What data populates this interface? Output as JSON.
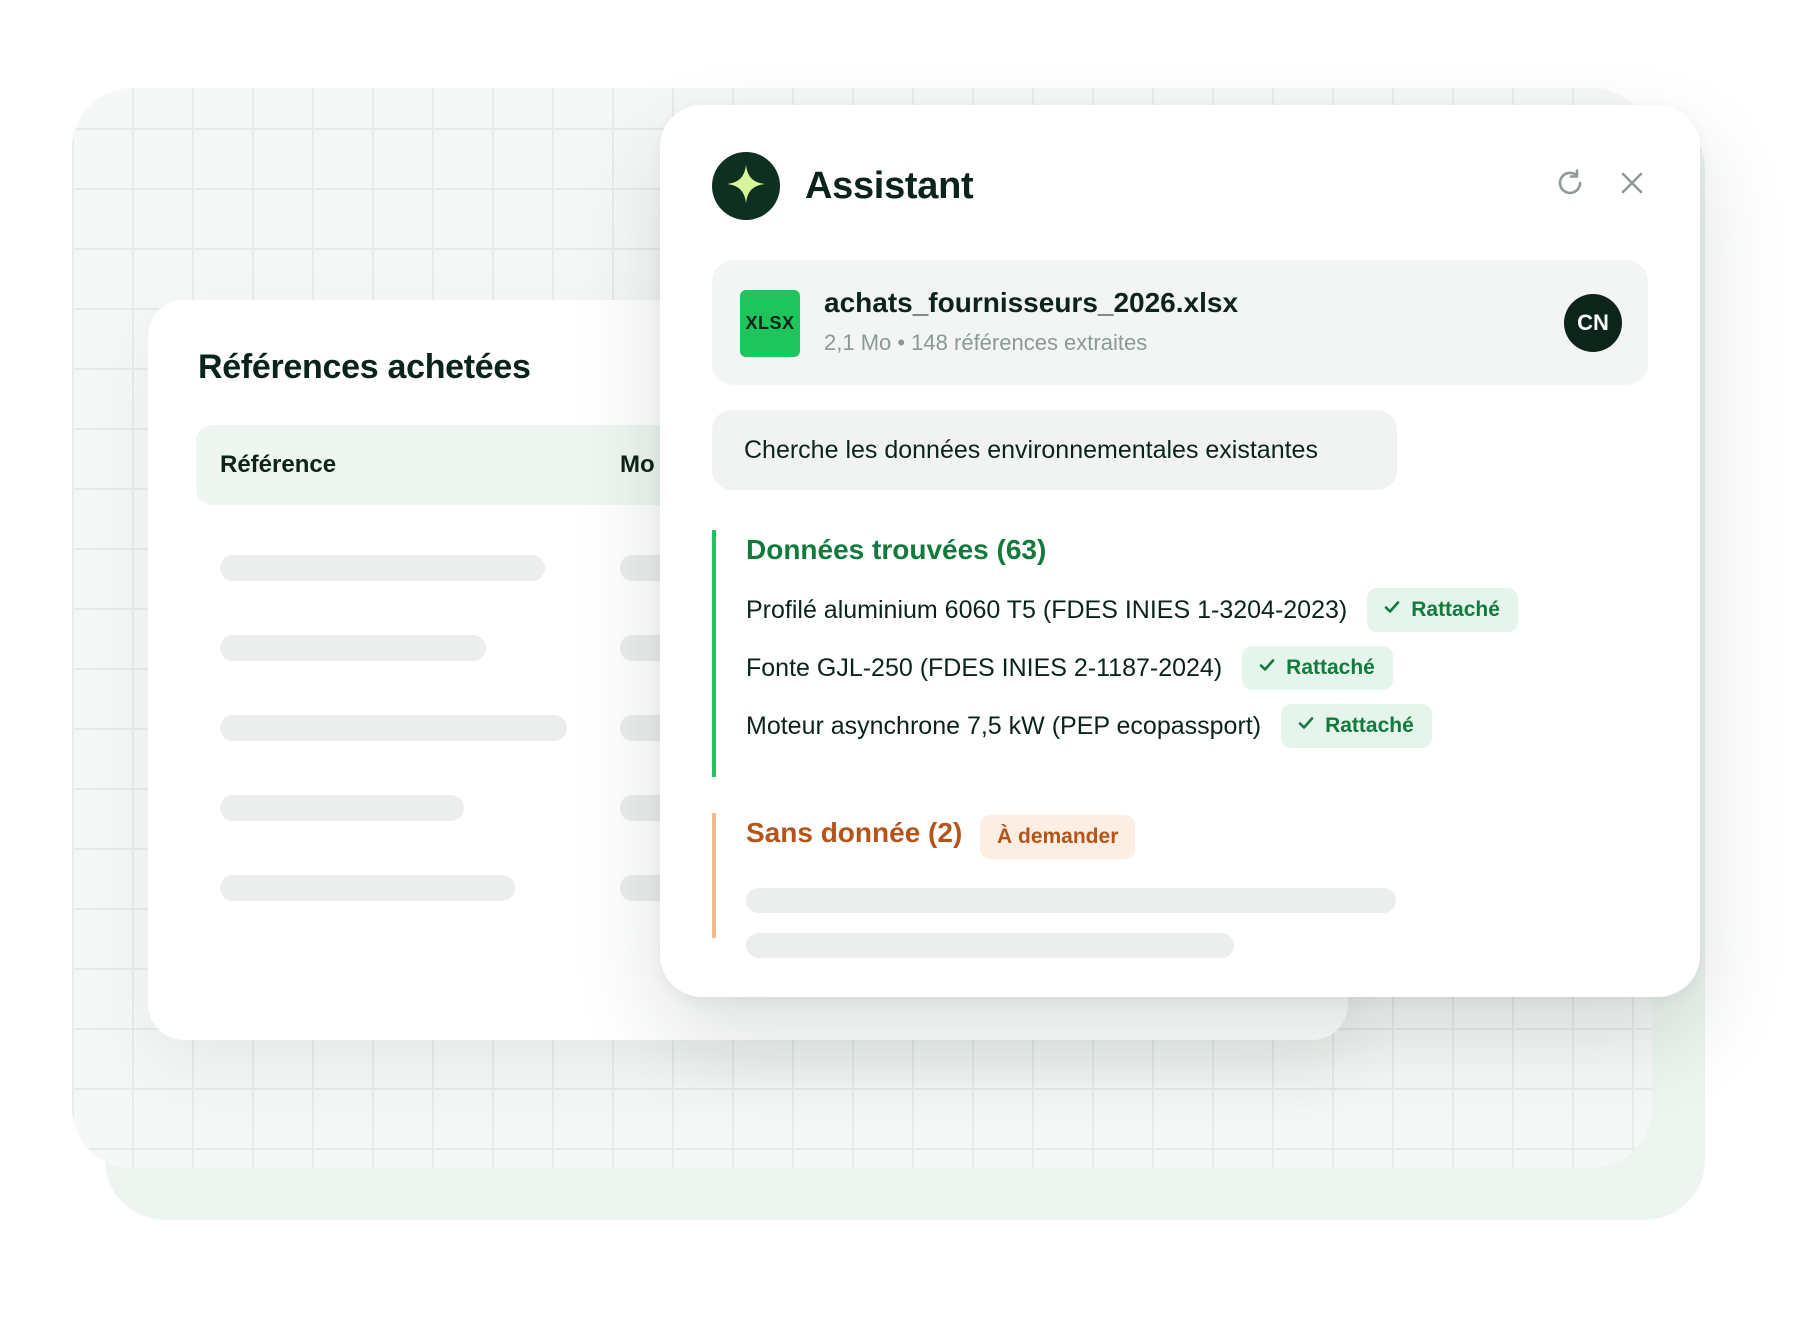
{
  "references_card": {
    "title": "Références achetées",
    "columns": [
      "Référence",
      "Mo"
    ]
  },
  "assistant": {
    "title": "Assistant",
    "icons": {
      "logo": "sparkle-icon",
      "refresh": "refresh-icon",
      "close": "close-icon"
    },
    "file": {
      "type_badge": "XLSX",
      "name": "achats_fournisseurs_2026.xlsx",
      "meta": "2,1 Mo • 148 références extraites",
      "avatar_initials": "CN"
    },
    "query": "Cherche les données environnementales existantes",
    "found": {
      "heading": "Données trouvées (63)",
      "items": [
        {
          "label": "Profilé aluminium 6060 T5 (FDES INIES 1-3204-2023)",
          "status": "Rattaché"
        },
        {
          "label": "Fonte GJL-250 (FDES INIES 2-1187-2024)",
          "status": "Rattaché"
        },
        {
          "label": "Moteur asynchrone 7,5 kW (PEP ecopassport)",
          "status": "Rattaché"
        }
      ]
    },
    "missing": {
      "heading": "Sans donnée (2)",
      "badge": "À demander"
    }
  },
  "colors": {
    "brand_dark": "#0e3021",
    "accent_green": "#1ec45c",
    "success_text": "#137a3d",
    "warning_text": "#b5541a",
    "warning_border": "#f2b98a"
  }
}
